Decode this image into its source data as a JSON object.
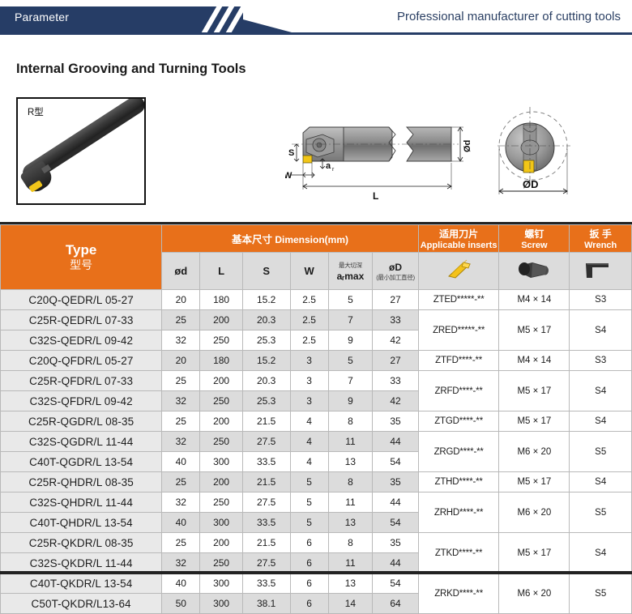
{
  "banner": {
    "title": "Parameter",
    "tagline": "Professional manufacturer of cutting tools",
    "navy": "#263d66"
  },
  "section": {
    "title": "Internal Grooving and Turning Tools"
  },
  "figure": {
    "photo_label": "R型",
    "dim_labels": [
      "S",
      "W",
      "a",
      "r",
      "L",
      "Ød",
      "ØD"
    ]
  },
  "table": {
    "accent": "#e8701a",
    "headers": {
      "type_en": "Type",
      "type_cn": "型号",
      "dimension_cn": "基本尺寸",
      "dimension_en": "Dimension(mm)",
      "inserts_cn": "适用刀片",
      "inserts_en": "Applicable inserts",
      "screw_cn": "螺钉",
      "screw_en": "Screw",
      "wrench_cn": "扳 手",
      "wrench_en": "Wrench"
    },
    "subheaders": {
      "d": "ød",
      "L": "L",
      "S": "S",
      "W": "W",
      "ap_cn": "最大切深",
      "ap_en": "aᵣmax",
      "D": "øD",
      "D_note": "(最小加工直径)"
    },
    "icons": {
      "insert": "insert-icon",
      "screw": "screw-icon",
      "wrench": "wrench-icon"
    },
    "rows": [
      {
        "type": "C20Q-QEDR/L 05-27",
        "d": "20",
        "L": "180",
        "S": "15.2",
        "W": "2.5",
        "ap": "5",
        "D": "27",
        "group": 0
      },
      {
        "type": "C25R-QEDR/L 07-33",
        "d": "25",
        "L": "200",
        "S": "20.3",
        "W": "2.5",
        "ap": "7",
        "D": "33",
        "group": 0
      },
      {
        "type": "C32S-QEDR/L 09-42",
        "d": "32",
        "L": "250",
        "S": "25.3",
        "W": "2.5",
        "ap": "9",
        "D": "42",
        "group": 0
      },
      {
        "type": "C20Q-QFDR/L 05-27",
        "d": "20",
        "L": "180",
        "S": "15.2",
        "W": "3",
        "ap": "5",
        "D": "27",
        "group": 1
      },
      {
        "type": "C25R-QFDR/L 07-33",
        "d": "25",
        "L": "200",
        "S": "20.3",
        "W": "3",
        "ap": "7",
        "D": "33",
        "group": 1
      },
      {
        "type": "C32S-QFDR/L 09-42",
        "d": "32",
        "L": "250",
        "S": "25.3",
        "W": "3",
        "ap": "9",
        "D": "42",
        "group": 1
      },
      {
        "type": "C25R-QGDR/L 08-35",
        "d": "25",
        "L": "200",
        "S": "21.5",
        "W": "4",
        "ap": "8",
        "D": "35",
        "group": 2
      },
      {
        "type": "C32S-QGDR/L 11-44",
        "d": "32",
        "L": "250",
        "S": "27.5",
        "W": "4",
        "ap": "11",
        "D": "44",
        "group": 2
      },
      {
        "type": "C40T-QGDR/L 13-54",
        "d": "40",
        "L": "300",
        "S": "33.5",
        "W": "4",
        "ap": "13",
        "D": "54",
        "group": 2
      },
      {
        "type": "C25R-QHDR/L 08-35",
        "d": "25",
        "L": "200",
        "S": "21.5",
        "W": "5",
        "ap": "8",
        "D": "35",
        "group": 3
      },
      {
        "type": "C32S-QHDR/L 11-44",
        "d": "32",
        "L": "250",
        "S": "27.5",
        "W": "5",
        "ap": "11",
        "D": "44",
        "group": 3
      },
      {
        "type": "C40T-QHDR/L 13-54",
        "d": "40",
        "L": "300",
        "S": "33.5",
        "W": "5",
        "ap": "13",
        "D": "54",
        "group": 3
      },
      {
        "type": "C25R-QKDR/L 08-35",
        "d": "25",
        "L": "200",
        "S": "21.5",
        "W": "6",
        "ap": "8",
        "D": "35",
        "group": 4
      },
      {
        "type": "C32S-QKDR/L 11-44",
        "d": "32",
        "L": "250",
        "S": "27.5",
        "W": "6",
        "ap": "11",
        "D": "44",
        "group": 4
      },
      {
        "type": "C40T-QKDR/L 13-54",
        "d": "40",
        "L": "300",
        "S": "33.5",
        "W": "6",
        "ap": "13",
        "D": "54",
        "group": 4
      },
      {
        "type": "C50T-QKDR/L13-64",
        "d": "50",
        "L": "300",
        "S": "38.1",
        "W": "6",
        "ap": "14",
        "D": "64",
        "group": 4
      }
    ],
    "groups": [
      {
        "inserts": [
          "ZTED*****-**",
          "ZRED*****-**"
        ],
        "screws": [
          "M4 × 14",
          "M5 × 17"
        ],
        "wrenches": [
          "S3",
          "S4"
        ],
        "rows": 3
      },
      {
        "inserts": [
          "ZTFD****-**",
          "ZRFD****-**"
        ],
        "screws": [
          "M4 × 14",
          "M5 × 17"
        ],
        "wrenches": [
          "S3",
          "S4"
        ],
        "rows": 3
      },
      {
        "inserts": [
          "ZTGD****-**",
          "ZRGD****-**"
        ],
        "screws": [
          "M5 × 17",
          "M6 × 20"
        ],
        "wrenches": [
          "S4",
          "S5"
        ],
        "rows": 3
      },
      {
        "inserts": [
          "ZTHD****-**",
          "ZRHD****-**"
        ],
        "screws": [
          "M5 × 17",
          "M6 × 20"
        ],
        "wrenches": [
          "S4",
          "S5"
        ],
        "rows": 3
      },
      {
        "inserts": [
          "ZTKD****-**",
          "ZRKD****-**"
        ],
        "screws": [
          "M5 × 17",
          "M6 × 20"
        ],
        "wrenches": [
          "S4",
          "S5"
        ],
        "rows": 4
      }
    ]
  }
}
